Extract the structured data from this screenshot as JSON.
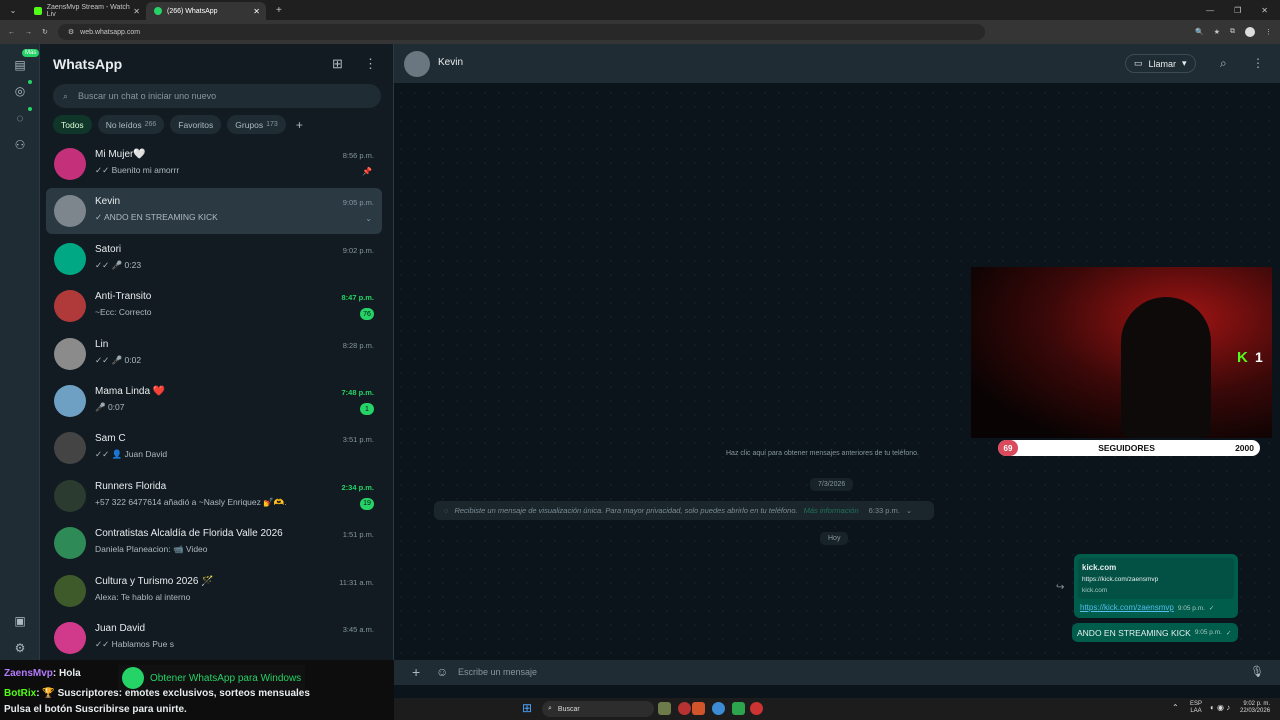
{
  "browser": {
    "tabs": [
      {
        "title": "ZaensMvp Stream - Watch Liv",
        "color": "#53fc18"
      },
      {
        "title": "(266) WhatsApp",
        "color": "#25d366"
      }
    ],
    "url": "web.whatsapp.com"
  },
  "rail": {
    "mas_badge": "Más"
  },
  "sidebar": {
    "title": "WhatsApp",
    "search_placeholder": "Buscar un chat o iniciar uno nuevo",
    "filters": [
      {
        "label": "Todos",
        "count": ""
      },
      {
        "label": "No leídos",
        "count": "266"
      },
      {
        "label": "Favoritos",
        "count": ""
      },
      {
        "label": "Grupos",
        "count": "173"
      }
    ],
    "add_filter": "+",
    "chats": [
      {
        "name": "Mi Mujer🤍",
        "preview": "✓✓ Buenito mi amorrr",
        "time": "8:56 p.m.",
        "unread": "",
        "pinned": true,
        "avatar": "#c4307a"
      },
      {
        "name": "Kevin",
        "preview": "✓ ANDO EN STREAMING KICK",
        "time": "9:05 p.m.",
        "unread": "",
        "selected": true,
        "avatar": "#7d868c"
      },
      {
        "name": "Satori",
        "preview": "✓✓ 🎤 0:23",
        "time": "9:02 p.m.",
        "unread": "",
        "avatar": "#00a884"
      },
      {
        "name": "Anti-Transito",
        "preview": "~Ecc: Correcto",
        "time": "8:47 p.m.",
        "unread": "76",
        "avatar": "#b03a3a"
      },
      {
        "name": "Lin",
        "preview": "✓✓ 🎤 0:02",
        "time": "8:28 p.m.",
        "unread": "",
        "avatar": "#8b8b8b"
      },
      {
        "name": "Mama Linda ❤️",
        "preview": "🎤 0:07",
        "time": "7:48 p.m.",
        "unread": "1",
        "avatar": "#6ea0c4"
      },
      {
        "name": "Sam  C",
        "preview": "✓✓ 👤 Juan David",
        "time": "3:51 p.m.",
        "unread": "",
        "avatar": "#444"
      },
      {
        "name": "Runners Florida",
        "preview": "+57 322 6477614 añadió a ~Nasly Enriquez 💅🫶.",
        "time": "2:34 p.m.",
        "unread": "19",
        "avatar": "#2c3b2f"
      },
      {
        "name": "Contratistas Alcaldía de Florida Valle 2026",
        "preview": "Daniela Planeacion: 📹 Video",
        "time": "1:51 p.m.",
        "unread": "",
        "avatar": "#2e8b57"
      },
      {
        "name": "Cultura y Turismo  2026 🪄",
        "preview": "Alexa: Te hablo al interno",
        "time": "11:31 a.m.",
        "unread": "",
        "avatar": "#3f5a2a"
      },
      {
        "name": "Juan David",
        "preview": "✓✓ Hablamos Pue s",
        "time": "3:45 a.m.",
        "unread": "",
        "avatar": "#d13a8a"
      }
    ]
  },
  "conversation": {
    "contact": "Kevin",
    "call_label": "Llamar",
    "load_older": "Haz clic aquí para obtener mensajes anteriores de tu teléfono.",
    "date1": "7/3/2026",
    "view_once_text": "Recibiste un mensaje de visualización única. Para mayor privacidad, solo puedes abrirlo en tu teléfono.",
    "view_once_link": "Más información",
    "view_once_time": "6:33 p.m.",
    "date2": "Hoy",
    "link_msg": {
      "preview_title": "kick.com",
      "preview_url": "https://kick.com/zaensmvp",
      "preview_domain": "kick.com",
      "link": "https://kick.com/zaensmvp",
      "time": "9:05 p.m."
    },
    "text_msg": {
      "text": "ANDO EN STREAMING KICK",
      "time": "9:05 p.m."
    },
    "composer_placeholder": "Escribe un mensaje"
  },
  "stream_overlay": {
    "viewer_count": "1",
    "followers_current": "69",
    "followers_label": "SEGUIDORES",
    "followers_goal": "2000",
    "chat_lines": [
      {
        "user": "ZaensMvp",
        "text": ": Hola"
      },
      {
        "user": "BotRix",
        "text": ": 🏆 Suscriptores: emotes exclusivos, sorteos mensuales"
      },
      {
        "user": "",
        "text": "Pulsa el botón Suscribirse para unirte."
      }
    ],
    "wa_promo": "Obtener WhatsApp para Windows"
  },
  "taskbar": {
    "search": "Buscar",
    "lang1": "ESP",
    "lang2": "LAA",
    "time": "9:02 p. m.",
    "date": "22/03/2026"
  }
}
